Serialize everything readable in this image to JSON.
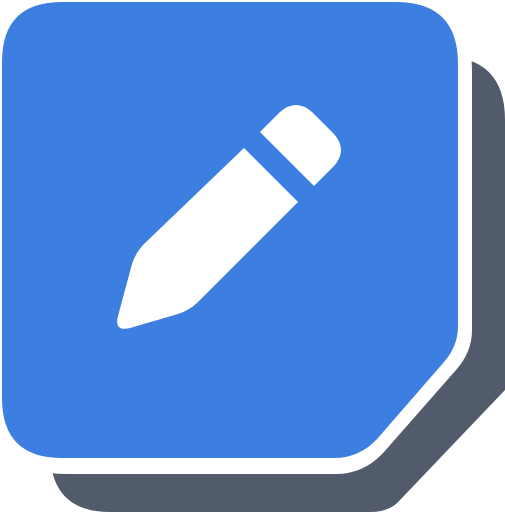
{
  "icon": {
    "name": "edit-pencil-app-icon",
    "glyph": "pencil-icon",
    "colors": {
      "tile": "#3d7fe1",
      "shadow_tile": "#525b6c",
      "border": "#ffffff",
      "glyph": "#ffffff"
    }
  }
}
